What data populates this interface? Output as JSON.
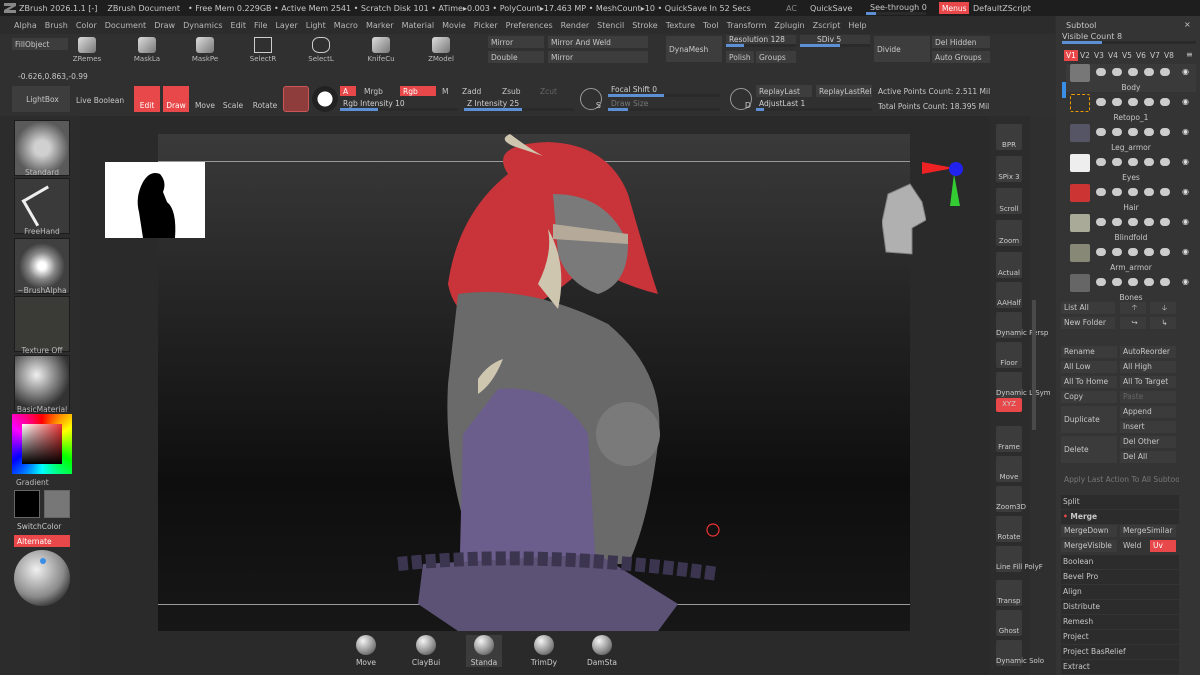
{
  "titlebar": {
    "app": "ZBrush 2026.1.1 [-]",
    "doc": "ZBrush Document",
    "stats": "• Free Mem 0.229GB • Active Mem 2541 • Scratch Disk 101 • ATime▸0.003 • PolyCount▸17.463 MP • MeshCount▸10 • QuickSave In 52 Secs",
    "ac": "AC",
    "quicksave": "QuickSave",
    "seethrough": "See-through 0",
    "menus": "Menus",
    "script": "DefaultZScript"
  },
  "menu": [
    "Alpha",
    "Brush",
    "Color",
    "Document",
    "Draw",
    "Dynamics",
    "Edit",
    "File",
    "Layer",
    "Light",
    "Macro",
    "Marker",
    "Material",
    "Movie",
    "Picker",
    "Preferences",
    "Render",
    "Stencil",
    "Stroke",
    "Texture",
    "Tool",
    "Transform",
    "Zplugin",
    "Zscript",
    "Help"
  ],
  "toolbar": {
    "fillobject": "FillObject",
    "tools": [
      "ZRemes",
      "MaskLa",
      "MaskPe",
      "SelectR",
      "SelectL",
      "KnifeCu",
      "ZModel"
    ],
    "coords": "-0.626,0.863,-0.99",
    "mirror": "Mirror",
    "mirror_weld": "Mirror And Weld",
    "double": "Double",
    "mirror2": "Mirror",
    "dynamesh": "DynaMesh",
    "resolution": "Resolution 128",
    "sdiv": "SDiv 5",
    "divide": "Divide",
    "polish": "Polish",
    "groups": "Groups",
    "del_hidden": "Del Hidden",
    "auto_groups": "Auto Groups",
    "lightbox": "LightBox",
    "live_boolean": "Live Boolean",
    "edit": "Edit",
    "draw": "Draw",
    "move": "Move",
    "scale": "Scale",
    "rotate": "Rotate",
    "a": "A",
    "mrgb": "Mrgb",
    "rgb": "Rgb",
    "m": "M",
    "zadd": "Zadd",
    "zsub": "Zsub",
    "zcut": "Zcut",
    "rgb_intensity": "Rgb Intensity 10",
    "z_intensity": "Z Intensity 25",
    "focal_shift": "Focal Shift 0",
    "draw_size": "Draw Size",
    "s": "S",
    "d": "D",
    "replay_last": "ReplayLast",
    "replay_last_rel": "ReplayLastRel",
    "adjust_last": "AdjustLast 1",
    "active_points": "Active Points Count: 2.511 Mil",
    "total_points": "Total Points Count: 18.395 Mil"
  },
  "left": {
    "standard": "Standard",
    "freehand": "FreeHand",
    "brushalpha": "~BrushAlpha",
    "texture_off": "Texture Off",
    "basic_material": "BasicMaterial",
    "gradient": "Gradient",
    "switchcolor": "SwitchColor",
    "alternate": "Alternate"
  },
  "right": [
    "BPR",
    "SPix 3",
    "Scroll",
    "Zoom",
    "Actual",
    "AAHalf",
    "Dynamic Persp",
    "Floor",
    "Dynamic L.Sym",
    "XYZ",
    "Frame",
    "Move",
    "Zoom3D",
    "Rotate",
    "Line Fill PolyF",
    "Transp",
    "Ghost",
    "Dynamic Solo"
  ],
  "subtool": {
    "title": "Subtool",
    "visible_count": "Visible Count 8",
    "versions": [
      "V1",
      "V2",
      "V3",
      "V4",
      "V5",
      "V6",
      "V7",
      "V8"
    ],
    "items": [
      "Body",
      "Retopo_1",
      "Leg_armor",
      "Eyes",
      "Hair",
      "Blindfold",
      "Arm_armor",
      "Bones"
    ],
    "list_all": "List All",
    "new_folder": "New Folder",
    "rename": "Rename",
    "autoreorder": "AutoReorder",
    "all_low": "All Low",
    "all_high": "All High",
    "all_to_home": "All To Home",
    "all_to_target": "All To Target",
    "copy": "Copy",
    "paste": "Paste",
    "duplicate": "Duplicate",
    "append": "Append",
    "insert": "Insert",
    "delete": "Delete",
    "del_other": "Del Other",
    "del_all": "Del All",
    "apply_last": "Apply Last Action To All Subtoo",
    "split": "Split",
    "merge": "Merge",
    "merge_down": "MergeDown",
    "merge_similar": "MergeSimilar",
    "merge_visible": "MergeVisible",
    "weld": "Weld",
    "uv": "Uv",
    "sections": [
      "Boolean",
      "Bevel Pro",
      "Align",
      "Distribute",
      "Remesh",
      "Project",
      "Project BasRelief",
      "Extract"
    ]
  },
  "bottom": [
    "Move",
    "ClayBui",
    "Standa",
    "TrimDy",
    "DamSta"
  ]
}
